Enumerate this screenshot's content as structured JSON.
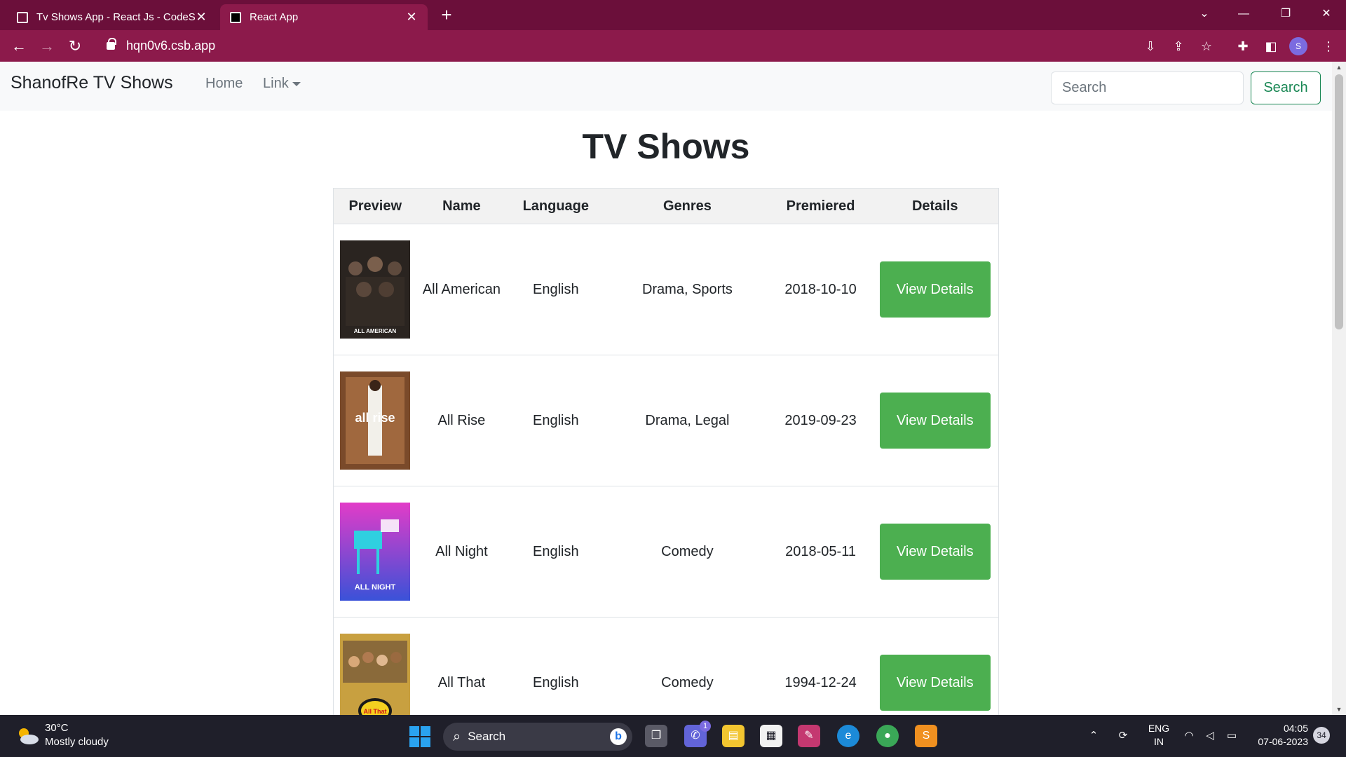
{
  "browser": {
    "tabs": [
      {
        "title": "Tv Shows App - React Js - CodeS...",
        "active": false
      },
      {
        "title": "React App",
        "active": true
      }
    ],
    "url": "hqn0v6.csb.app",
    "profile_initial": "S"
  },
  "colors": {
    "chrome_titlebar": "#6b0f3a",
    "chrome_toolbar": "#8c1a4b",
    "details_button": "#4caf50",
    "search_button": "#198754"
  },
  "navbar": {
    "brand": "ShanofRe TV Shows",
    "links": {
      "home": "Home",
      "link": "Link"
    },
    "search_placeholder": "Search",
    "search_button": "Search"
  },
  "page": {
    "heading": "TV Shows",
    "columns": {
      "preview": "Preview",
      "name": "Name",
      "language": "Language",
      "genres": "Genres",
      "premiered": "Premiered",
      "details": "Details"
    },
    "details_button": "View Details",
    "shows": [
      {
        "name": "All American",
        "language": "English",
        "genres": "Drama, Sports",
        "premiered": "2018-10-10",
        "poster_text": "ALL AMERICAN"
      },
      {
        "name": "All Rise",
        "language": "English",
        "genres": "Drama, Legal",
        "premiered": "2019-09-23",
        "poster_text": "all rise"
      },
      {
        "name": "All Night",
        "language": "English",
        "genres": "Comedy",
        "premiered": "2018-05-11",
        "poster_text": "ALL NIGHT"
      },
      {
        "name": "All That",
        "language": "English",
        "genres": "Comedy",
        "premiered": "1994-12-24",
        "poster_text": "All That"
      }
    ]
  },
  "taskbar": {
    "weather_temp": "30°C",
    "weather_text": "Mostly cloudy",
    "search_label": "Search",
    "teams_badge": "1",
    "lang_primary": "ENG",
    "lang_secondary": "IN",
    "time": "04:05",
    "date": "07-06-2023",
    "notifications": "34"
  }
}
